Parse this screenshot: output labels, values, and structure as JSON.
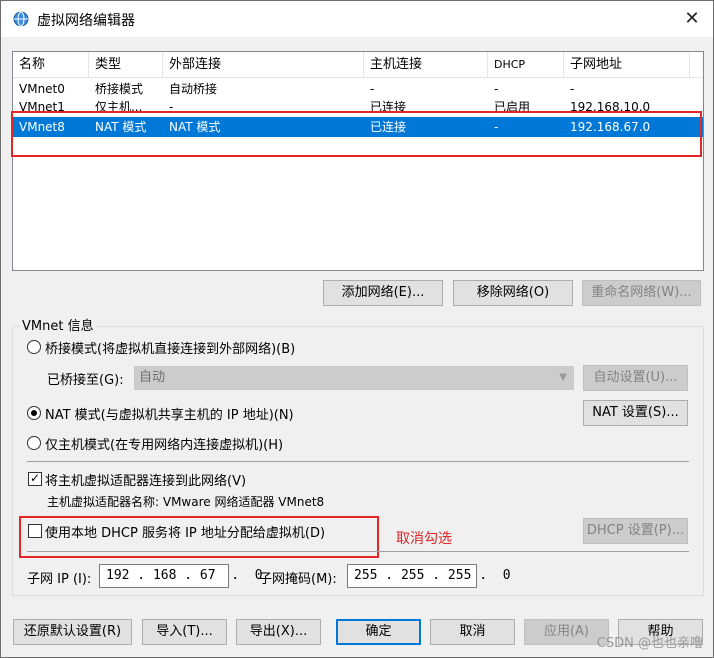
{
  "window": {
    "title": "虚拟网络编辑器",
    "close_glyph": "✕"
  },
  "table": {
    "headers": [
      "名称",
      "类型",
      "外部连接",
      "主机连接",
      "DHCP",
      "子网地址"
    ],
    "rows": [
      [
        "VMnet0",
        "桥接模式",
        "自动桥接",
        "-",
        "-",
        "-"
      ],
      [
        "VMnet1",
        "仅主机...",
        "-",
        "已连接",
        "已启用",
        "192.168.10.0"
      ],
      [
        "VMnet8",
        "NAT 模式",
        "NAT 模式",
        "已连接",
        "-",
        "192.168.67.0"
      ]
    ],
    "selected_row": 2
  },
  "network_buttons": {
    "add": "添加网络(E)...",
    "remove": "移除网络(O)",
    "rename": "重命名网络(W)..."
  },
  "vmnet_info": {
    "group_label": "VMnet 信息",
    "bridge_radio": "桥接模式(将虚拟机直接连接到外部网络)(B)",
    "bridged_to_label": "已桥接至(G):",
    "bridged_to_value": "自动",
    "auto_settings": "自动设置(U)...",
    "nat_radio": "NAT 模式(与虚拟机共享主机的 IP 地址)(N)",
    "nat_settings": "NAT 设置(S)...",
    "hostonly_radio": "仅主机模式(在专用网络内连接虚拟机)(H)",
    "connect_adapter_check": "将主机虚拟适配器连接到此网络(V)",
    "adapter_name": "主机虚拟适配器名称: VMware 网络适配器 VMnet8",
    "dhcp_check": "使用本地 DHCP 服务将 IP 地址分配给虚拟机(D)",
    "dhcp_settings": "DHCP 设置(P)...",
    "subnet_ip_label": "子网 IP (I):",
    "subnet_ip_value": "192 . 168 . 67  .  0",
    "subnet_mask_label": "子网掩码(M):",
    "subnet_mask_value": "255 . 255 . 255 .  0"
  },
  "annotation": "取消勾选",
  "footer_buttons": {
    "restore": "还原默认设置(R)",
    "import": "导入(T)...",
    "export": "导出(X)...",
    "ok": "确定",
    "cancel": "取消",
    "apply": "应用(A)",
    "help": "帮助"
  },
  "watermark": "CSDN @也也亲噜",
  "colors": {
    "selection": "#0078d7",
    "highlight": "#e32626"
  }
}
